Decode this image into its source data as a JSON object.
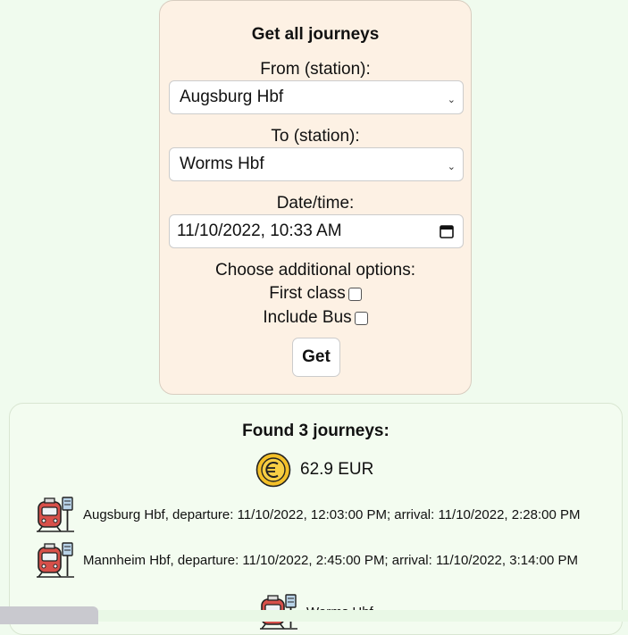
{
  "form": {
    "title": "Get all journeys",
    "from_label": "From (station):",
    "from_value": "Augsburg Hbf",
    "to_label": "To (station):",
    "to_value": "Worms Hbf",
    "datetime_label": "Date/time:",
    "datetime_value": "11/10/2022, 10:33 AM",
    "options_label": "Choose additional options:",
    "first_class_label": "First class",
    "first_class_checked": false,
    "include_bus_label": "Include Bus",
    "include_bus_checked": false,
    "submit_label": "Get"
  },
  "results": {
    "heading": "Found 3 journeys:",
    "price": "62.9 EUR",
    "legs": [
      "Augsburg Hbf, departure: 11/10/2022, 12:03:00 PM; arrival: 11/10/2022, 2:28:00 PM",
      "Mannheim Hbf, departure: 11/10/2022, 2:45:00 PM; arrival: 11/10/2022, 3:14:00 PM"
    ],
    "destination": "Worms Hbf"
  },
  "colors": {
    "page_bg": "#f0fbee",
    "form_bg": "#fdf1e4",
    "train_red": "#d7504a",
    "coin_gold": "#f4c028"
  }
}
